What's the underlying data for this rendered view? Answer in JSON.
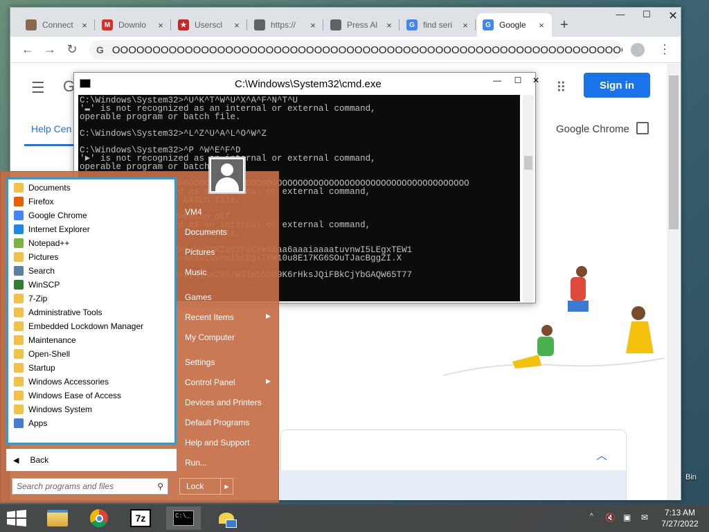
{
  "browser": {
    "tabs": [
      {
        "label": "Connect",
        "color": "#8a6a4f",
        "glyph": ""
      },
      {
        "label": "Downlo",
        "color": "#d93025",
        "glyph": "M"
      },
      {
        "label": "Userscl",
        "color": "#c62828",
        "glyph": "★"
      },
      {
        "label": "https://",
        "color": "#5f6368",
        "glyph": ""
      },
      {
        "label": "Press Al",
        "color": "#5f6368",
        "glyph": ""
      },
      {
        "label": "find seri",
        "color": "#4285f4",
        "glyph": "G"
      },
      {
        "label": "Google",
        "color": "#4285f4",
        "glyph": "G"
      }
    ],
    "new_tab": "+",
    "close_glyph": "×",
    "url": "OOOOOOOOOOOOOOOOOOOOOOOOOOOOOOOOOOOOOOOOOOOOOOOOOOOOOOOOOOOOOOOOOOOOOOOOOO"
  },
  "page": {
    "g_letter": "G",
    "help_center": "Help Cen",
    "sign_in": "Sign in",
    "google_chrome": "Google Chrome"
  },
  "cmd": {
    "title": "C:\\Windows\\System32\\cmd.exe",
    "lines": [
      "C:\\Windows\\System32>^U^K^T^W^U^X^A^F^N^T^U",
      "'▬' is not recognized as an internal or external command,",
      "operable program or batch file.",
      "",
      "C:\\Windows\\System32>^L^Z^U^A^L^O^W^Z",
      "",
      "C:\\Windows\\System32>^P ^W^E^F^D",
      "'►' is not recognized as an internal or external command,",
      "operable program or batch file.",
      "",
      "C:\\Windows\\System32>OOOOOOOOOOOOOOOOOOOOOOOOOOOOOOOOOOOOOOOOOOOOOOOOOOOOOOO",
      "'' is not recognized as an internal or external command,",
      "operable program or batch file.",
      "",
      "C:\\Windows\\System32>@echo off",
      "'' is not recognized as an internal or external command,",
      "operable program or batch file.",
      "",
      "C:\\Windows\\System32>iahv36KIq6iFzCYeaaaa6aaaiaaaatuvnwI5LEgxTEW1",
      "C:\\Windows\\System32>aaaatuvnwI5LEgxTEW10u8E17KG6SOuTJacBggZI.X",
      "",
      "C:\\Windows\\System32>Sy4jKw2ah/WJlp5bGb9K6rHksJQiFBkCjYbGAQW65T77"
    ]
  },
  "start_menu": {
    "programs": [
      {
        "label": "Documents",
        "icon": "folder-docs-icon",
        "color": "#f0c24b"
      },
      {
        "label": "Firefox",
        "icon": "firefox-icon",
        "color": "#e66000"
      },
      {
        "label": "Google Chrome",
        "icon": "chrome-icon",
        "color": "#4285f4"
      },
      {
        "label": "Internet Explorer",
        "icon": "ie-icon",
        "color": "#1e88e5"
      },
      {
        "label": "Notepad++",
        "icon": "notepadpp-icon",
        "color": "#7cb342"
      },
      {
        "label": "Pictures",
        "icon": "folder-pictures-icon",
        "color": "#f0c24b"
      },
      {
        "label": "Search",
        "icon": "search-icon",
        "color": "#5c7fa3"
      },
      {
        "label": "WinSCP",
        "icon": "winscp-icon",
        "color": "#2e7d32"
      },
      {
        "label": "7-Zip",
        "icon": "folder-icon",
        "color": "#f0c24b"
      },
      {
        "label": "Administrative Tools",
        "icon": "folder-icon",
        "color": "#f0c24b"
      },
      {
        "label": "Embedded Lockdown Manager",
        "icon": "folder-icon",
        "color": "#f0c24b"
      },
      {
        "label": "Maintenance",
        "icon": "folder-icon",
        "color": "#f0c24b"
      },
      {
        "label": "Open-Shell",
        "icon": "folder-icon",
        "color": "#f0c24b"
      },
      {
        "label": "Startup",
        "icon": "folder-icon",
        "color": "#f0c24b"
      },
      {
        "label": "Windows Accessories",
        "icon": "folder-icon",
        "color": "#f0c24b"
      },
      {
        "label": "Windows Ease of Access",
        "icon": "folder-icon",
        "color": "#f0c24b"
      },
      {
        "label": "Windows System",
        "icon": "folder-icon",
        "color": "#f0c24b"
      },
      {
        "label": "Apps",
        "icon": "apps-icon",
        "color": "#4a7bd0"
      }
    ],
    "back": "Back",
    "search_placeholder": "Search programs and files",
    "right_items": [
      {
        "label": "VM4",
        "submenu": false
      },
      {
        "label": "Documents",
        "submenu": false
      },
      {
        "label": "Pictures",
        "submenu": false
      },
      {
        "label": "Music",
        "submenu": false
      },
      {
        "label": "Games",
        "submenu": false
      },
      {
        "label": "Recent Items",
        "submenu": true
      },
      {
        "label": "My Computer",
        "submenu": false
      },
      {
        "label": "Settings",
        "submenu": false
      },
      {
        "label": "Control Panel",
        "submenu": true
      },
      {
        "label": "Devices and Printers",
        "submenu": false
      },
      {
        "label": "Default Programs",
        "submenu": false
      },
      {
        "label": "Help and Support",
        "submenu": false
      },
      {
        "label": "Run...",
        "submenu": false
      }
    ],
    "lock": "Lock"
  },
  "desktop": {
    "recycle_bin": "Bin"
  },
  "taskbar": {
    "apps": [
      "file-explorer-icon",
      "chrome-icon",
      "7zip-icon",
      "cmd-icon",
      "network-icon"
    ],
    "seven_zip_label": "7z",
    "time": "7:13 AM",
    "date": "7/27/2022"
  }
}
